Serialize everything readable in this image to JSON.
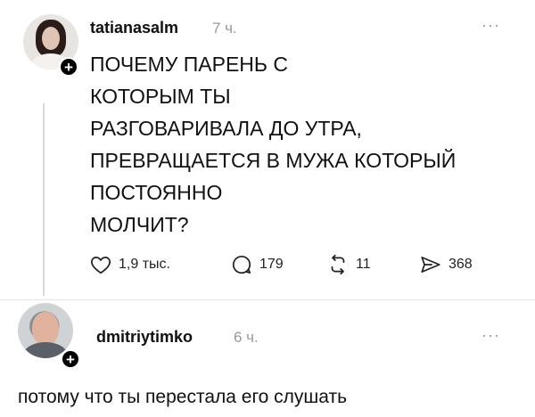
{
  "post": {
    "username": "tatianasalm",
    "time": "7 ч.",
    "text_lines": [
      "ПОЧЕМУ ПАРЕНЬ С",
      "КОТОРЫМ ТЫ",
      "РАЗГОВАРИВАЛА ДО УТРА,",
      "ПРЕВРАЩАЕТСЯ В МУЖА КОТОРЫЙ",
      "ПОСТОЯННО",
      "МОЛЧИТ?"
    ],
    "actions": {
      "likes": "1,9 тыс.",
      "replies": "179",
      "reposts": "11",
      "shares": "368"
    }
  },
  "reply": {
    "username": "dmitriytimko",
    "time": "6 ч.",
    "text": "потому что ты перестала его слушать"
  },
  "icons": {
    "follow_badge": "+",
    "more": "···"
  }
}
